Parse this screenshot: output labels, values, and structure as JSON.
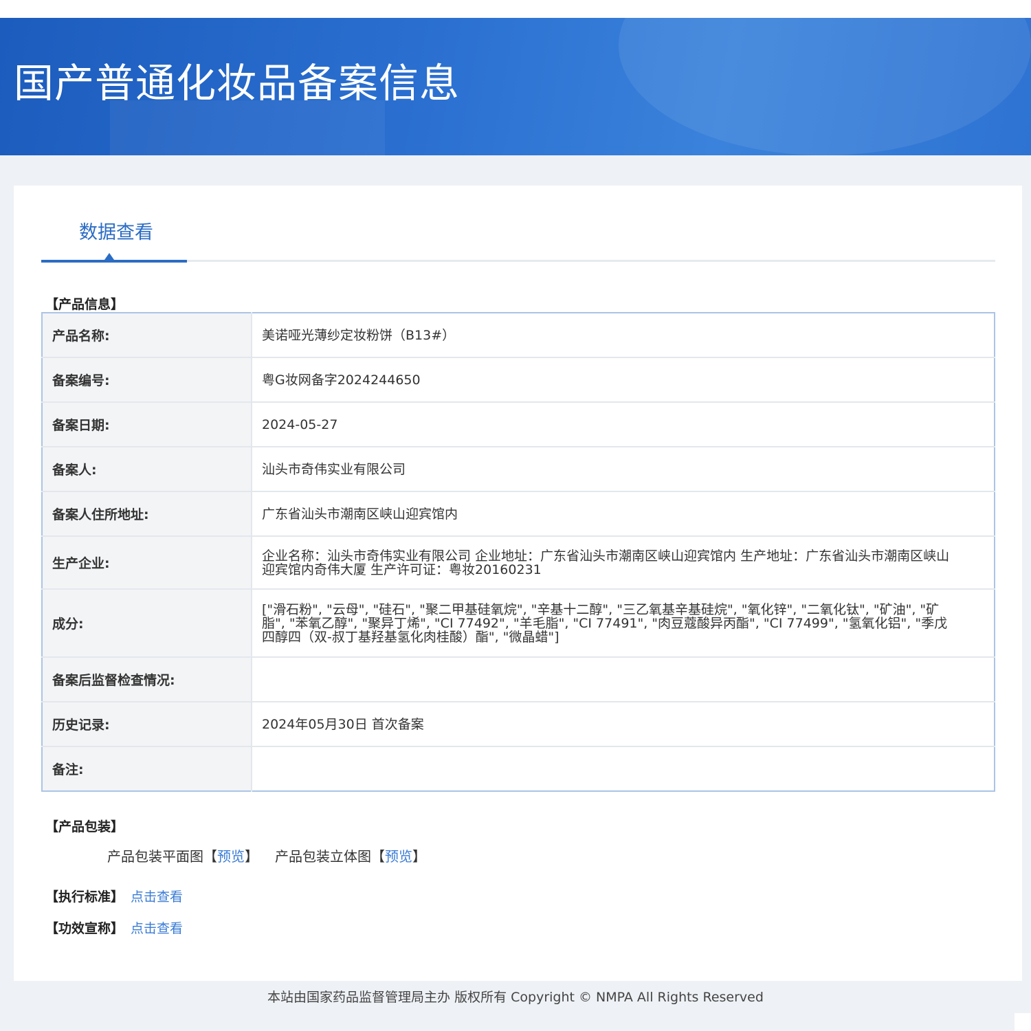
{
  "banner": {
    "title": "国产普通化妆品备案信息"
  },
  "tabs": [
    {
      "label": "数据查看",
      "active": true
    }
  ],
  "product_info": {
    "section_title": "【产品信息】",
    "rows": [
      {
        "label": "产品名称:",
        "value": "美诺哑光薄纱定妆粉饼（B13#）"
      },
      {
        "label": "备案编号:",
        "value": "粤G妆网备字2024244650"
      },
      {
        "label": "备案日期:",
        "value": "2024-05-27"
      },
      {
        "label": "备案人:",
        "value": "汕头市奇伟实业有限公司"
      },
      {
        "label": "备案人住所地址:",
        "value": "广东省汕头市潮南区峡山迎宾馆内"
      },
      {
        "label": "生产企业:",
        "value": "企业名称：汕头市奇伟实业有限公司 企业地址：广东省汕头市潮南区峡山迎宾馆内 生产地址：广东省汕头市潮南区峡山迎宾馆内奇伟大厦 生产许可证：粤妆20160231"
      },
      {
        "label": "成分:",
        "value": "[\"滑石粉\", \"云母\", \"硅石\", \"聚二甲基硅氧烷\", \"辛基十二醇\", \"三乙氧基辛基硅烷\", \"氧化锌\", \"二氧化钛\", \"矿油\", \"矿脂\", \"苯氧乙醇\", \"聚异丁烯\", \"CI 77492\", \"羊毛脂\", \"CI 77491\", \"肉豆蔻酸异丙酯\", \"CI 77499\", \"氢氧化铝\", \"季戊四醇四（双-叔丁基羟基氢化肉桂酸）酯\", \"微晶蜡\"]"
      },
      {
        "label": "备案后监督检查情况:",
        "value": ""
      },
      {
        "label": "历史记录:",
        "value": "2024年05月30日 首次备案"
      },
      {
        "label": "备注:",
        "value": ""
      }
    ]
  },
  "packaging": {
    "section_title": "【产品包装】",
    "flat_label": "产品包装平面图",
    "solid_label": "产品包装立体图",
    "bracket_open": "【",
    "bracket_close": "】",
    "preview_link": "预览"
  },
  "standard": {
    "label": "【执行标准】",
    "link": "点击查看"
  },
  "efficacy": {
    "label": "【功效宣称】",
    "link": "点击查看"
  },
  "footer": {
    "text": "本站由国家药品监督管理局主办 版权所有 Copyright © NMPA All Rights Reserved"
  }
}
